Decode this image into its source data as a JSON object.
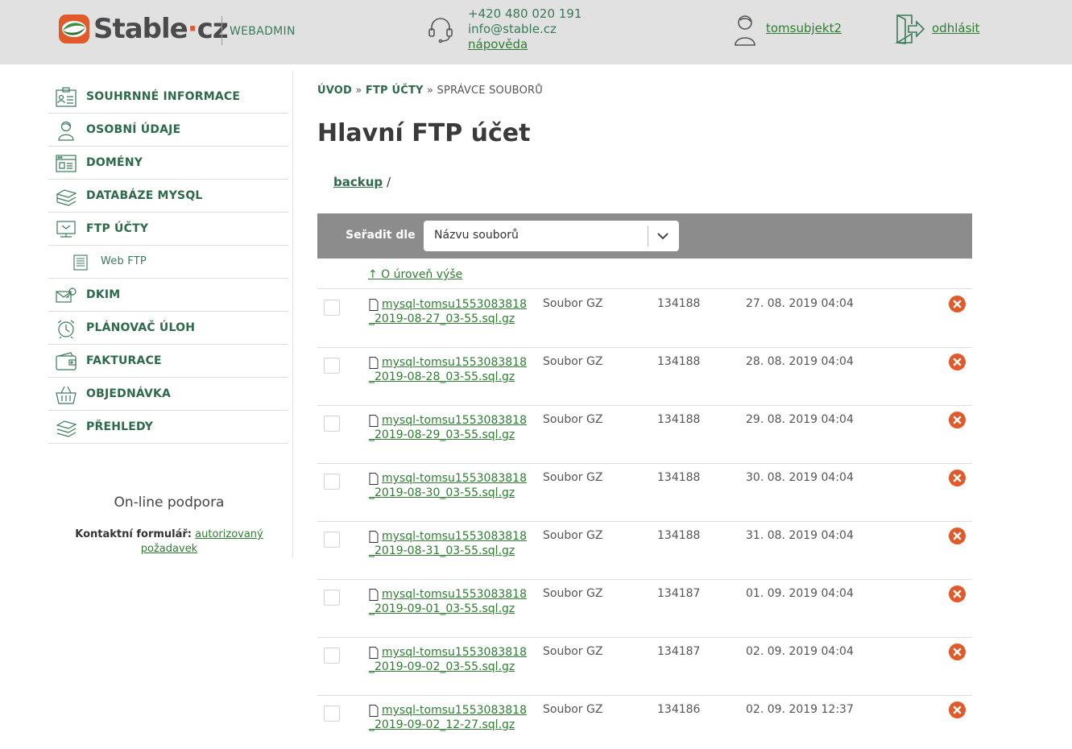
{
  "header": {
    "logo": "Stable",
    "logo_dot": "·",
    "logo_tld": "cz",
    "product": "WEBADMIN",
    "phone": "+420 480 020 191",
    "email": "info@stable.cz",
    "help": "nápověda",
    "user": "tomsubjekt2",
    "logout": "odhlásit"
  },
  "colors": {
    "accent": "#2e7d32",
    "brand_orange": "#e05a2a",
    "header_bg": "#e1e1e1",
    "sortbar_bg": "#8c8c8c"
  },
  "sidebar": {
    "items": [
      {
        "label": "SOUHRNNÉ INFORMACE",
        "icon": "summary-icon"
      },
      {
        "label": "OSOBNÍ ÚDAJE",
        "icon": "person-icon"
      },
      {
        "label": "DOMÉNY",
        "icon": "domain-window-icon"
      },
      {
        "label": "DATABÁZE MYSQL",
        "icon": "database-icon"
      },
      {
        "label": "FTP ÚČTY",
        "icon": "ftp-icon"
      },
      {
        "label": "Web FTP",
        "icon": "web-ftp-icon"
      },
      {
        "label": "DKIM",
        "icon": "dkim-key-icon"
      },
      {
        "label": "PLÁNOVAČ ÚLOH",
        "icon": "alarm-clock-icon"
      },
      {
        "label": "FAKTURACE",
        "icon": "wallet-icon"
      },
      {
        "label": "OBJEDNÁVKA",
        "icon": "basket-icon"
      },
      {
        "label": "PŘEHLEDY",
        "icon": "reports-icon"
      }
    ],
    "support_title": "On-line podpora",
    "support_label": "Kontaktní formulář:",
    "support_link": "autorizovaný požadavek"
  },
  "breadcrumb": {
    "home": "ÚVOD",
    "sep": "»",
    "ftp": "FTP ÚČTY",
    "current": "SPRÁVCE SOUBORŮ"
  },
  "page_title": "Hlavní FTP účet",
  "path": {
    "folder": "backup",
    "sep": "/"
  },
  "sort": {
    "label": "Seřadit dle",
    "value": "Názvu souborů"
  },
  "up_link": "↑ O úroveň výše",
  "files": [
    {
      "name": "mysql-tomsu1553083818_2019-08-27_03-55.sql.gz",
      "type": "Soubor GZ",
      "size": "134188",
      "date": "27. 08. 2019 04:04"
    },
    {
      "name": "mysql-tomsu1553083818_2019-08-28_03-55.sql.gz",
      "type": "Soubor GZ",
      "size": "134188",
      "date": "28. 08. 2019 04:04"
    },
    {
      "name": "mysql-tomsu1553083818_2019-08-29_03-55.sql.gz",
      "type": "Soubor GZ",
      "size": "134188",
      "date": "29. 08. 2019 04:04"
    },
    {
      "name": "mysql-tomsu1553083818_2019-08-30_03-55.sql.gz",
      "type": "Soubor GZ",
      "size": "134188",
      "date": "30. 08. 2019 04:04"
    },
    {
      "name": "mysql-tomsu1553083818_2019-08-31_03-55.sql.gz",
      "type": "Soubor GZ",
      "size": "134188",
      "date": "31. 08. 2019 04:04"
    },
    {
      "name": "mysql-tomsu1553083818_2019-09-01_03-55.sql.gz",
      "type": "Soubor GZ",
      "size": "134187",
      "date": "01. 09. 2019 04:04"
    },
    {
      "name": "mysql-tomsu1553083818_2019-09-02_03-55.sql.gz",
      "type": "Soubor GZ",
      "size": "134187",
      "date": "02. 09. 2019 04:04"
    },
    {
      "name": "mysql-tomsu1553083818_2019-09-02_12-27.sql.gz",
      "type": "Soubor GZ",
      "size": "134186",
      "date": "02. 09. 2019 12:37"
    }
  ]
}
